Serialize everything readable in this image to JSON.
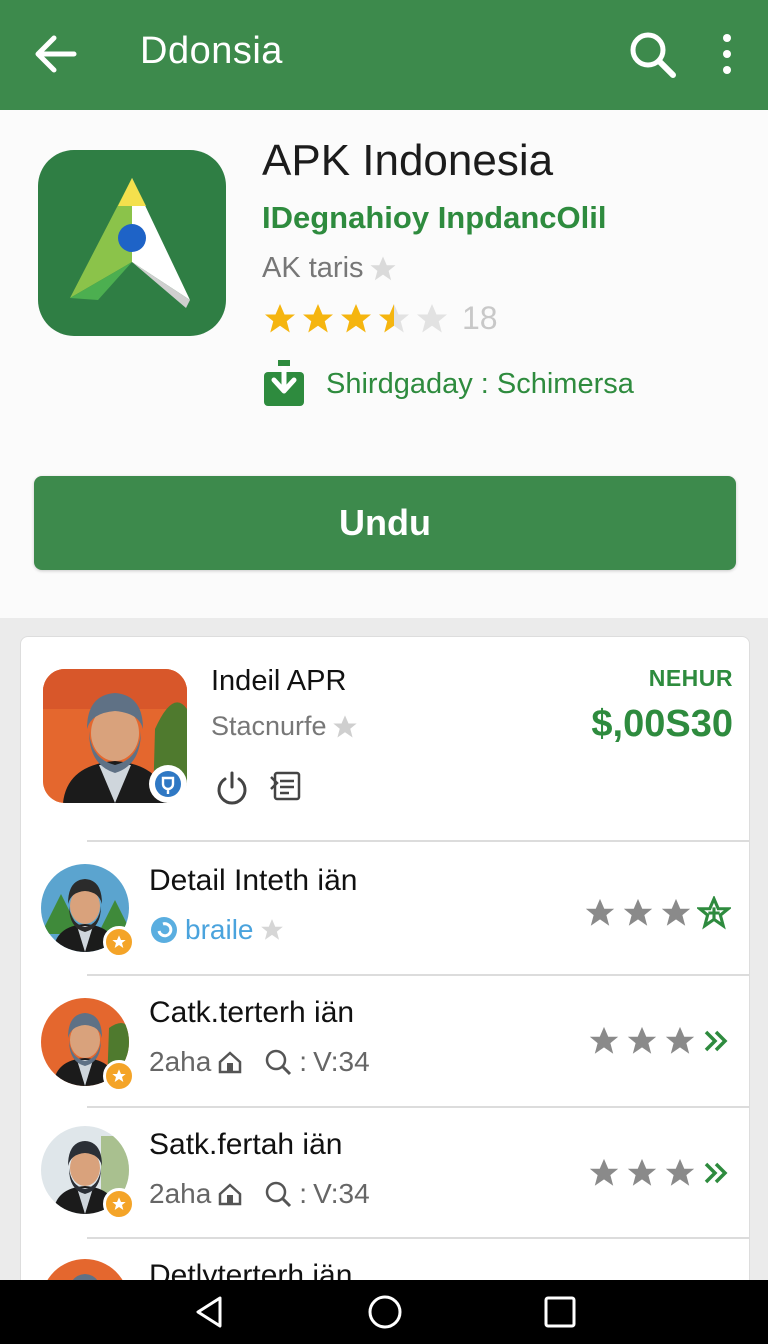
{
  "app_bar": {
    "title": "Ddonsia",
    "back_icon": "arrow-back-icon",
    "search_icon": "search-icon",
    "menu_icon": "more-vert-icon",
    "color": "#3d8a4c"
  },
  "app": {
    "name": "APK Indonesia",
    "developer": "IDegnahioy InpdancOlil",
    "category": "AK taris",
    "rating": 3.5,
    "rating_count": "18",
    "download_label": "Shirdgaday : Schimersa",
    "install_label": "Undu"
  },
  "featured": {
    "title": "Indeil APR",
    "subtitle": "Stacnurfe",
    "label": "NEHUR",
    "price": "$,00S30"
  },
  "list": [
    {
      "title": "Detail Inteth iän",
      "sub_text": "braile",
      "sub_style": "link",
      "stars": 3,
      "trailing": "star-outline"
    },
    {
      "title": "Catk.terterh iän",
      "sub_text": "2aha",
      "meta": "V:34",
      "sub_style": "meta",
      "stars": 3,
      "trailing": "chevrons"
    },
    {
      "title": "Satk.fertah iän",
      "sub_text": "2aha",
      "meta": "V:34",
      "sub_style": "meta",
      "stars": 3,
      "trailing": "chevrons"
    },
    {
      "title": "Detlyterterh iän"
    }
  ],
  "colors": {
    "primary": "#3d8a4c",
    "accent_text": "#2e8b3e",
    "star_gold": "#f5b50f",
    "star_gray": "#8a8a8a"
  }
}
